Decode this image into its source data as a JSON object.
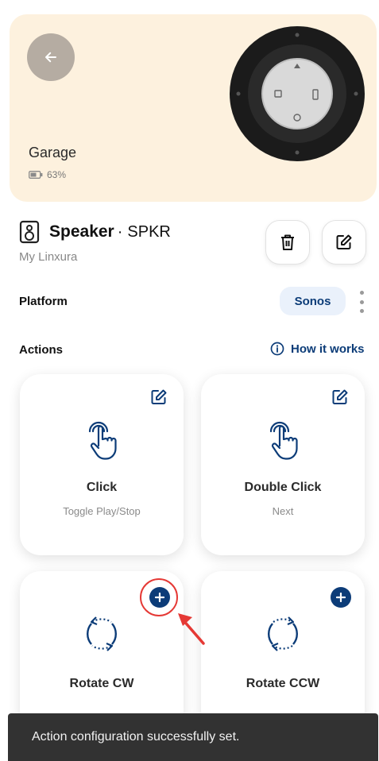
{
  "device": {
    "name": "Garage",
    "battery_percent": "63%"
  },
  "header": {
    "type_label": "Speaker",
    "separator": "·",
    "code": "SPKR",
    "owner": "My Linxura"
  },
  "platform": {
    "label": "Platform",
    "value": "Sonos"
  },
  "actions": {
    "label": "Actions",
    "how_link": "How it works",
    "cards": [
      {
        "title": "Click",
        "subtitle": "Toggle Play/Stop",
        "icon": "hand-tap-icon",
        "configured": true
      },
      {
        "title": "Double Click",
        "subtitle": "Next",
        "icon": "hand-tap-icon",
        "configured": true
      },
      {
        "title": "Rotate CW",
        "subtitle": "",
        "icon": "rotate-cw-icon",
        "configured": false
      },
      {
        "title": "Rotate CCW",
        "subtitle": "",
        "icon": "rotate-ccw-icon",
        "configured": false
      }
    ]
  },
  "snackbar": {
    "message": "Action configuration successfully set."
  },
  "colors": {
    "hero_bg": "#fdf1de",
    "accent": "#0c3c78",
    "chip_bg": "#eaf1fb",
    "callout": "#e53935"
  }
}
